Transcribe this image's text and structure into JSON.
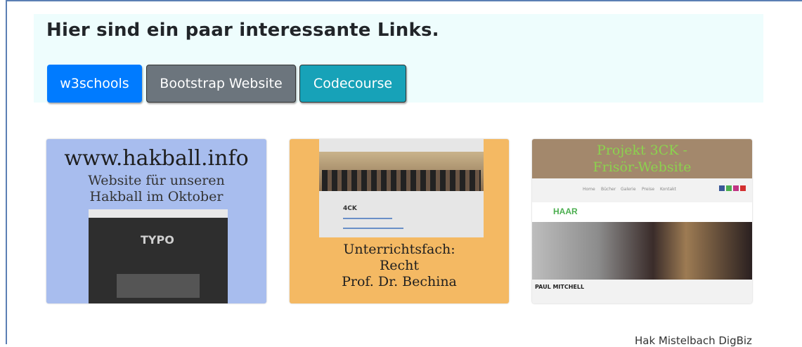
{
  "jumbotron": {
    "title": "Hier sind ein paar interessante Links.",
    "buttons": [
      {
        "label": "w3schools",
        "color": "#007bff"
      },
      {
        "label": "Bootstrap Website",
        "color": "#6c757d"
      },
      {
        "label": "Codecourse",
        "color": "#17a2b8"
      }
    ]
  },
  "cards": [
    {
      "title": "www.hakball.info",
      "subtitle_line1": "Website für unseren",
      "subtitle_line2": "Hakball im Oktober",
      "screenshot_brand": "TYPO",
      "background": "#a8bdee"
    },
    {
      "screenshot_label": "4CK",
      "title_line1": "Unterrichtsfach:",
      "title_line2": "Recht",
      "title_line3": "Prof. Dr. Bechina",
      "background": "#f4b963"
    },
    {
      "title_line1": "Projekt 3CK -",
      "title_line2": "Frisör-Website",
      "nav_home": "Home",
      "nav_buecher": "Bücher",
      "nav_galerie": "Galerie",
      "nav_preise": "Preise",
      "nav_kontakt": "Kontakt",
      "logo_text": "HAAR",
      "footer_brand": "PAUL MITCHELL",
      "background": "#f2f2f2"
    }
  ],
  "footer": {
    "text": "Hak Mistelbach DigBiz"
  }
}
